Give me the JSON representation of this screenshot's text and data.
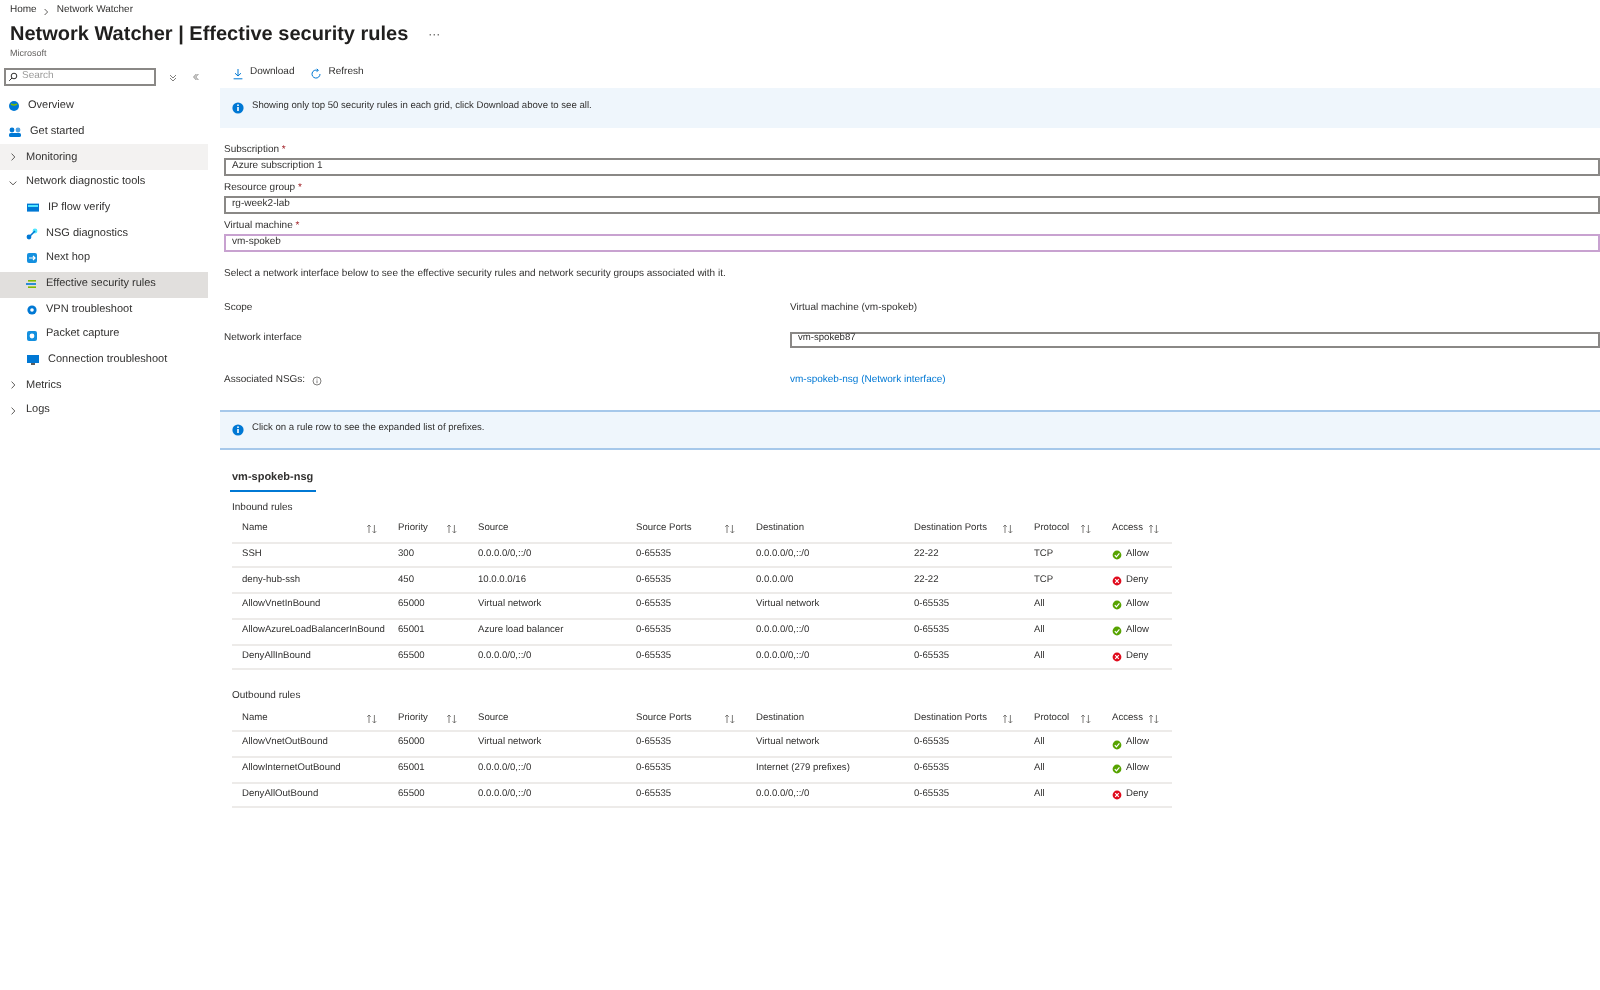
{
  "breadcrumb": [
    "Home",
    "Network Watcher"
  ],
  "title": {
    "text": "Network Watcher | Effective security rules",
    "subtitle": "Microsoft",
    "more": "···"
  },
  "sidebar": {
    "search": {
      "placeholder": "Search"
    },
    "items": [
      {
        "label": "Overview",
        "selected": false,
        "hovered": false
      },
      {
        "label": "Get started",
        "selected": false,
        "hovered": false
      },
      {
        "label": "Monitoring",
        "selected": false,
        "hovered": true,
        "expanded": false
      },
      {
        "label": "Network diagnostic tools",
        "selected": false,
        "hovered": false,
        "expanded": true,
        "children": [
          {
            "label": "IP flow verify",
            "selected": false
          },
          {
            "label": "NSG diagnostics",
            "selected": false
          },
          {
            "label": "Next hop",
            "selected": false
          },
          {
            "label": "Effective security rules",
            "selected": true
          },
          {
            "label": "VPN troubleshoot",
            "selected": false
          },
          {
            "label": "Packet capture",
            "selected": false
          },
          {
            "label": "Connection troubleshoot",
            "selected": false
          }
        ]
      },
      {
        "label": "Metrics",
        "selected": false,
        "hovered": false,
        "expanded": false
      },
      {
        "label": "Logs",
        "selected": false,
        "hovered": false,
        "expanded": false
      }
    ]
  },
  "toolbar": [
    "Download",
    "Refresh"
  ],
  "notice": "Showing only top 50 security rules in each grid, click Download above to see all.",
  "fields": [
    {
      "label": "Subscription",
      "required_mark": "*",
      "value": "Azure subscription 1",
      "focused": false
    },
    {
      "label": "Resource group",
      "required_mark": "*",
      "value": "rg-week2-lab",
      "focused": false
    },
    {
      "label": "Virtual machine",
      "required_mark": "*",
      "value": "vm-spokeb",
      "focused": true
    }
  ],
  "instruction": "Select a network interface below to see the effective security rules and network security groups associated with it.",
  "scope": {
    "label": "Scope",
    "value": "Virtual machine (vm-spokeb)"
  },
  "network_interface": {
    "label": "Network interface",
    "value": "vm-spokeb87"
  },
  "associated_nsgs": {
    "label": "Associated NSGs:",
    "link": "vm-spokeb-nsg (Network interface)"
  },
  "hint": "Click on a rule row to see the expanded list of prefixes.",
  "nsg_tabs": [
    {
      "label": "vm-spokeb-nsg",
      "selected": true
    }
  ],
  "tables": [
    {
      "title": "Inbound rules",
      "columns": [
        {
          "label": "Name",
          "sortable": true
        },
        {
          "label": "Priority",
          "sortable": true
        },
        {
          "label": "Source",
          "sortable": false
        },
        {
          "label": "Source Ports",
          "sortable": true
        },
        {
          "label": "Destination",
          "sortable": false
        },
        {
          "label": "Destination Ports",
          "sortable": true
        },
        {
          "label": "Protocol",
          "sortable": true
        },
        {
          "label": "Access",
          "sortable": true
        }
      ],
      "rows": [
        {
          "cells": [
            "SSH",
            "300",
            "0.0.0.0/0,::/0",
            "0-65535",
            "0.0.0.0/0,::/0",
            "22-22",
            "TCP"
          ],
          "access": "Allow",
          "kind": "allow"
        },
        {
          "cells": [
            "deny-hub-ssh",
            "450",
            "10.0.0.0/16",
            "0-65535",
            "0.0.0.0/0",
            "22-22",
            "TCP"
          ],
          "access": "Deny",
          "kind": "deny"
        },
        {
          "cells": [
            "AllowVnetInBound",
            "65000",
            "Virtual network",
            "0-65535",
            "Virtual network",
            "0-65535",
            "All"
          ],
          "access": "Allow",
          "kind": "allow"
        },
        {
          "cells": [
            "AllowAzureLoadBalancerInBound",
            "65001",
            "Azure load balancer",
            "0-65535",
            "0.0.0.0/0,::/0",
            "0-65535",
            "All"
          ],
          "access": "Allow",
          "kind": "allow"
        },
        {
          "cells": [
            "DenyAllInBound",
            "65500",
            "0.0.0.0/0,::/0",
            "0-65535",
            "0.0.0.0/0,::/0",
            "0-65535",
            "All"
          ],
          "access": "Deny",
          "kind": "deny"
        }
      ]
    },
    {
      "title": "Outbound rules",
      "columns": [
        {
          "label": "Name",
          "sortable": true
        },
        {
          "label": "Priority",
          "sortable": true
        },
        {
          "label": "Source",
          "sortable": false
        },
        {
          "label": "Source Ports",
          "sortable": true
        },
        {
          "label": "Destination",
          "sortable": false
        },
        {
          "label": "Destination Ports",
          "sortable": true
        },
        {
          "label": "Protocol",
          "sortable": true
        },
        {
          "label": "Access",
          "sortable": true
        }
      ],
      "rows": [
        {
          "cells": [
            "AllowVnetOutBound",
            "65000",
            "Virtual network",
            "0-65535",
            "Virtual network",
            "0-65535",
            "All"
          ],
          "access": "Allow",
          "kind": "allow"
        },
        {
          "cells": [
            "AllowInternetOutBound",
            "65001",
            "0.0.0.0/0,::/0",
            "0-65535",
            "Internet (279 prefixes)",
            "0-65535",
            "All"
          ],
          "access": "Allow",
          "kind": "allow"
        },
        {
          "cells": [
            "DenyAllOutBound",
            "65500",
            "0.0.0.0/0,::/0",
            "0-65535",
            "0.0.0.0/0,::/0",
            "0-65535",
            "All"
          ],
          "access": "Deny",
          "kind": "deny"
        }
      ]
    }
  ]
}
